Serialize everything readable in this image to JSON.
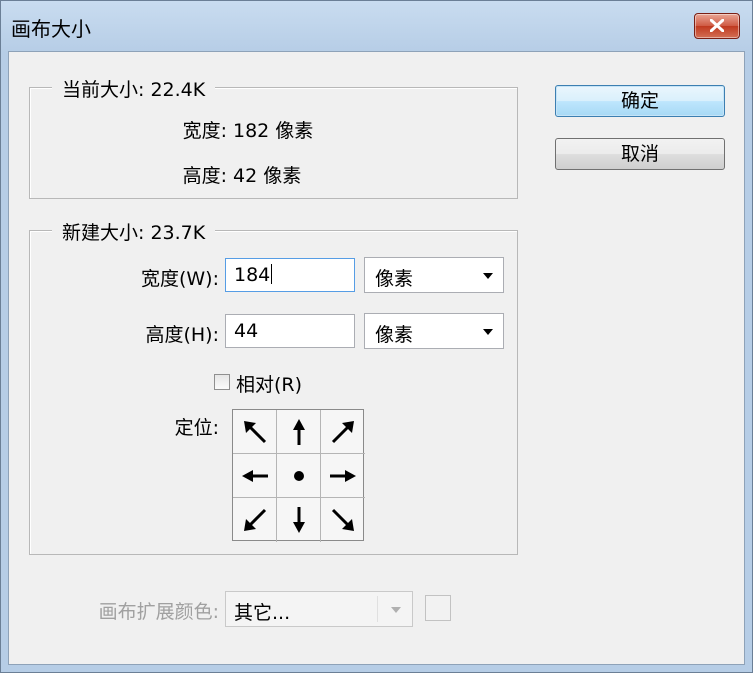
{
  "window": {
    "title": "画布大小",
    "close_label": "关闭"
  },
  "buttons": {
    "ok": "确定",
    "cancel": "取消"
  },
  "current_size": {
    "title": "当前大小: 22.4K",
    "width_label": "宽度:",
    "width_value": "182 像素",
    "height_label": "高度:",
    "height_value": "42 像素"
  },
  "new_size": {
    "title": "新建大小: 23.7K",
    "width_label": "宽度(W):",
    "width_value": "184",
    "width_unit": "像素",
    "height_label": "高度(H):",
    "height_value": "44",
    "height_unit": "像素",
    "relative_label": "相对(R)",
    "relative_checked": false,
    "anchor_label": "定位:",
    "anchor_cells": [
      {
        "name": "arrow-up-left-icon"
      },
      {
        "name": "arrow-up-icon"
      },
      {
        "name": "arrow-up-right-icon"
      },
      {
        "name": "arrow-left-icon"
      },
      {
        "name": "center-dot-icon"
      },
      {
        "name": "arrow-right-icon"
      },
      {
        "name": "arrow-down-left-icon"
      },
      {
        "name": "arrow-down-icon"
      },
      {
        "name": "arrow-down-right-icon"
      }
    ]
  },
  "extension_color": {
    "label": "画布扩展颜色:",
    "value": "其它..."
  },
  "colors": {
    "title_bar": "#b6cde6",
    "client_bg": "#f0f0f0",
    "default_button": "#bee6fd",
    "close_button": "#c0391f"
  }
}
